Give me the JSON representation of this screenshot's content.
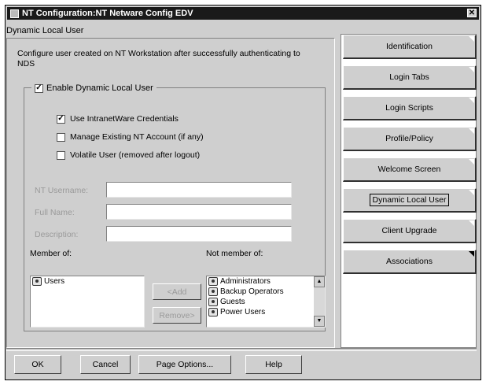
{
  "window": {
    "title": "NT Configuration:NT Netware Config EDV"
  },
  "panel": {
    "caption": "Dynamic Local User",
    "description": "Configure user created on NT Workstation after successfully authenticating to NDS",
    "enable_label": "Enable Dynamic Local User",
    "options": [
      {
        "label": "Use IntranetWare Credentials",
        "checked": true
      },
      {
        "label": "Manage Existing NT Account (if any)",
        "checked": false
      },
      {
        "label": "Volatile User (removed after logout)",
        "checked": false
      }
    ],
    "fields": [
      {
        "label": "NT Username:",
        "value": ""
      },
      {
        "label": "Full Name:",
        "value": ""
      },
      {
        "label": "Description:",
        "value": ""
      }
    ],
    "member_of": {
      "label": "Member of:",
      "items": [
        "Users"
      ]
    },
    "not_member_of": {
      "label": "Not member of:",
      "items": [
        "Administrators",
        "Backup Operators",
        "Guests",
        "Power Users"
      ]
    },
    "add_label": "<Add",
    "remove_label": "Remove>"
  },
  "tabs": [
    {
      "label": "Identification",
      "active": false
    },
    {
      "label": "Login Tabs",
      "active": false
    },
    {
      "label": "Login Scripts",
      "active": false
    },
    {
      "label": "Profile/Policy",
      "active": false
    },
    {
      "label": "Welcome Screen",
      "active": false
    },
    {
      "label": "Dynamic Local User",
      "active": true
    },
    {
      "label": "Client Upgrade",
      "active": false
    },
    {
      "label": "Associations",
      "active": false
    }
  ],
  "footer": {
    "ok": "OK",
    "cancel": "Cancel",
    "page_options": "Page Options...",
    "help": "Help"
  },
  "icons": {
    "checkbox_checked": "check-icon",
    "scroll_up": "arrow-up-icon",
    "scroll_down": "arrow-down-icon",
    "group": "group-icon"
  }
}
